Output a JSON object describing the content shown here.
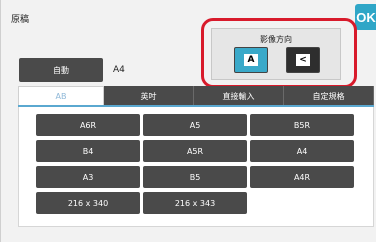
{
  "header": {
    "title": "原稿",
    "ok_label": "OK"
  },
  "orientation": {
    "label": "影像方向",
    "options": [
      {
        "glyph": "A",
        "selected": true
      },
      {
        "glyph": "<",
        "selected": false
      }
    ]
  },
  "auto": {
    "label": "自動",
    "value": "A4"
  },
  "tabs": [
    {
      "label": "AB",
      "active": true
    },
    {
      "label": "英吋",
      "active": false
    },
    {
      "label": "直接輸入",
      "active": false
    },
    {
      "label": "自定規格",
      "active": false
    }
  ],
  "sizes": [
    "A6R",
    "A5",
    "B5R",
    "B4",
    "A5R",
    "A4",
    "A3",
    "B5",
    "A4R",
    "216 x 340",
    "216 x 343"
  ]
}
